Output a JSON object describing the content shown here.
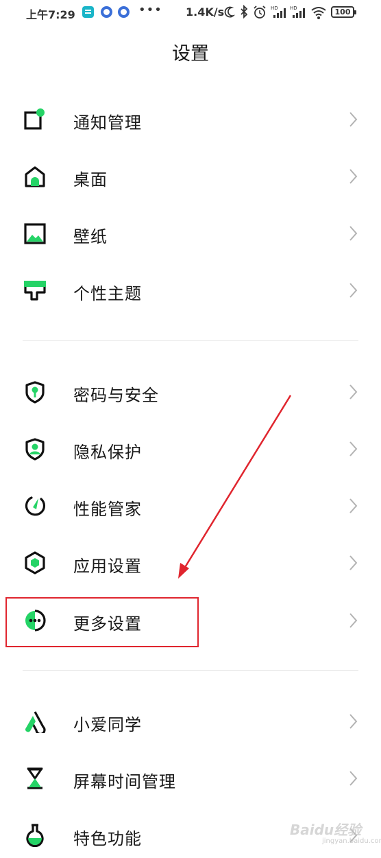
{
  "status_bar": {
    "time": "上午7:29",
    "overflow": "•••",
    "net_speed": "1.4K/s",
    "battery": "100"
  },
  "page": {
    "title": "设置"
  },
  "colors": {
    "accent": "#25d366",
    "icon": "#111111",
    "highlight": "#e0252e"
  },
  "groups": [
    {
      "items": [
        {
          "label": "通知管理",
          "icon": "notification-icon"
        },
        {
          "label": "桌面",
          "icon": "home-icon"
        },
        {
          "label": "壁纸",
          "icon": "wallpaper-icon"
        },
        {
          "label": "个性主题",
          "icon": "theme-icon"
        }
      ]
    },
    {
      "items": [
        {
          "label": "密码与安全",
          "icon": "lock-shield-icon"
        },
        {
          "label": "隐私保护",
          "icon": "privacy-shield-icon"
        },
        {
          "label": "性能管家",
          "icon": "performance-icon"
        },
        {
          "label": "应用设置",
          "icon": "app-settings-icon"
        },
        {
          "label": "更多设置",
          "icon": "more-settings-icon"
        }
      ]
    },
    {
      "items": [
        {
          "label": "小爱同学",
          "icon": "xiaoai-icon"
        },
        {
          "label": "屏幕时间管理",
          "icon": "hourglass-icon"
        },
        {
          "label": "特色功能",
          "icon": "flask-icon"
        }
      ]
    }
  ],
  "watermark": {
    "brand": "Baidu经验",
    "url": "jingyan.baidu.com"
  }
}
